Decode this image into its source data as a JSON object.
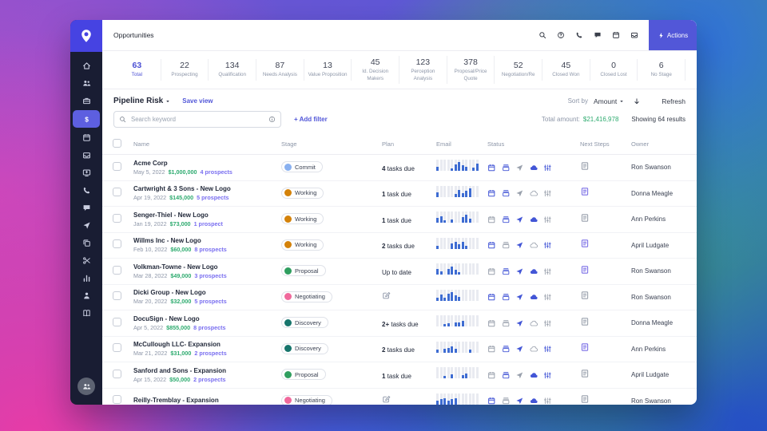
{
  "header": {
    "title": "Opportunities",
    "icons": [
      "search",
      "help",
      "phone",
      "chat",
      "calendar",
      "inbox"
    ],
    "actions_label": "Actions"
  },
  "sidebar": {
    "icons": [
      "home",
      "users",
      "briefcase",
      "dollar",
      "calendar",
      "inbox",
      "screen-plus",
      "phone",
      "chat",
      "send",
      "copy",
      "scissors",
      "chart",
      "user",
      "book"
    ],
    "active_index": 3,
    "footer_icon": "users"
  },
  "stats": [
    {
      "value": "63",
      "label": "Total"
    },
    {
      "value": "22",
      "label": "Prospecting"
    },
    {
      "value": "134",
      "label": "Qualification"
    },
    {
      "value": "87",
      "label": "Needs Analysis"
    },
    {
      "value": "13",
      "label": "Value Proposition"
    },
    {
      "value": "45",
      "label": "Id. Decision Makers"
    },
    {
      "value": "123",
      "label": "Perception Analysis"
    },
    {
      "value": "378",
      "label": "Proposal/Price Quote"
    },
    {
      "value": "52",
      "label": "Negotiation/Re"
    },
    {
      "value": "45",
      "label": "Closed Won"
    },
    {
      "value": "0",
      "label": "Closed Lost"
    },
    {
      "value": "6",
      "label": "No Stage"
    }
  ],
  "toolbar": {
    "view_name": "Pipeline Risk",
    "save_view": "Save view",
    "sort_by": "Sort by",
    "sort_value": "Amount",
    "refresh": "Refresh"
  },
  "filters": {
    "search_placeholder": "Search keyword",
    "add_filter": "+ Add filter",
    "total_amount_label": "Total amount:",
    "total_amount": "$21,416,978",
    "results": "Showing 64 results"
  },
  "table": {
    "headers": [
      "Name",
      "Stage",
      "Plan",
      "Email",
      "Status",
      "Next Steps",
      "Owner"
    ],
    "rows": [
      {
        "name": "Acme Corp",
        "date": "May 5, 2022",
        "amount": "$1,000,000",
        "prospects": "4 prospects",
        "stage": "Commit",
        "plan": {
          "bold": "4",
          "text": " tasks due",
          "icon": false
        },
        "bars": [
          0.35,
          0,
          0,
          0,
          0.2,
          0.6,
          0.8,
          0.55,
          0.35,
          0,
          0.3,
          0.65
        ],
        "status": {
          "calendar": true,
          "tray": true,
          "send": false,
          "cloud": true,
          "pulse": true
        },
        "note": false,
        "owner": "Ron Swanson"
      },
      {
        "name": "Cartwright & 3 Sons - New Logo",
        "date": "Apr 19, 2022",
        "amount": "$145,000",
        "prospects": "5 prospects",
        "stage": "Working",
        "plan": {
          "bold": "1",
          "text": " task due",
          "icon": false
        },
        "bars": [
          0.4,
          0,
          0,
          0,
          0,
          0.3,
          0.6,
          0.35,
          0.55,
          0.75,
          0,
          0
        ],
        "status": {
          "calendar": true,
          "tray": true,
          "send": false,
          "cloud": false,
          "pulse": false
        },
        "note": true,
        "owner": "Donna Meagle"
      },
      {
        "name": "Senger-Thiel - New Logo",
        "date": "Jan 19, 2022",
        "amount": "$73,000",
        "prospects": "1 prospect",
        "stage": "Working",
        "plan": {
          "bold": "1",
          "text": " task due",
          "icon": false
        },
        "bars": [
          0.45,
          0.6,
          0.25,
          0,
          0.3,
          0,
          0,
          0.55,
          0.7,
          0.35,
          0,
          0
        ],
        "status": {
          "calendar": false,
          "tray": true,
          "send": true,
          "cloud": true,
          "pulse": false
        },
        "note": false,
        "owner": "Ann Perkins"
      },
      {
        "name": "Willms Inc - New Logo",
        "date": "Feb 10, 2022",
        "amount": "$60,000",
        "prospects": "8 prospects",
        "stage": "Working",
        "plan": {
          "bold": "2",
          "text": " tasks due",
          "icon": false
        },
        "bars": [
          0.25,
          0,
          0,
          0,
          0.5,
          0.65,
          0.4,
          0.6,
          0.3,
          0,
          0,
          0
        ],
        "status": {
          "calendar": true,
          "tray": false,
          "send": true,
          "cloud": false,
          "pulse": true
        },
        "note": true,
        "owner": "April Ludgate"
      },
      {
        "name": "Volkman-Towne - New Logo",
        "date": "Mar 28, 2022",
        "amount": "$49,000",
        "prospects": "3 prospects",
        "stage": "Proposal",
        "plan": {
          "bold": "",
          "text": "Up to date",
          "icon": false
        },
        "bars": [
          0.55,
          0.3,
          0,
          0.5,
          0.7,
          0.45,
          0.25,
          0,
          0,
          0,
          0,
          0
        ],
        "status": {
          "calendar": false,
          "tray": true,
          "send": true,
          "cloud": true,
          "pulse": false
        },
        "note": true,
        "owner": "Ron Swanson"
      },
      {
        "name": "Dicki Group - New Logo",
        "date": "Mar 20, 2022",
        "amount": "$32,000",
        "prospects": "5 prospects",
        "stage": "Negotiating",
        "plan": {
          "bold": "",
          "text": "",
          "icon": true
        },
        "bars": [
          0.3,
          0.55,
          0.3,
          0.65,
          0.8,
          0.45,
          0.35,
          0,
          0,
          0,
          0,
          0
        ],
        "status": {
          "calendar": true,
          "tray": true,
          "send": true,
          "cloud": true,
          "pulse": false
        },
        "note": false,
        "owner": "Ron Swanson"
      },
      {
        "name": "DocuSign - New Logo",
        "date": "Apr 5, 2022",
        "amount": "$855,000",
        "prospects": "8 prospects",
        "stage": "Discovery",
        "plan": {
          "bold": "2+",
          "text": " tasks due",
          "icon": false
        },
        "bars": [
          0,
          0,
          0.25,
          0.3,
          0,
          0.4,
          0.35,
          0.5,
          0,
          0,
          0,
          0
        ],
        "status": {
          "calendar": false,
          "tray": false,
          "send": true,
          "cloud": false,
          "pulse": false
        },
        "note": false,
        "owner": "Donna Meagle"
      },
      {
        "name": "McCullough LLC- Expansion",
        "date": "Mar 21, 2022",
        "amount": "$31,000",
        "prospects": "2 prospects",
        "stage": "Discovery",
        "plan": {
          "bold": "2",
          "text": " tasks due",
          "icon": false
        },
        "bars": [
          0.3,
          0,
          0.35,
          0.4,
          0.55,
          0.35,
          0,
          0,
          0,
          0.25,
          0,
          0
        ],
        "status": {
          "calendar": false,
          "tray": true,
          "send": true,
          "cloud": false,
          "pulse": true
        },
        "note": true,
        "owner": "Ann Perkins"
      },
      {
        "name": "Sanford and Sons - Expansion",
        "date": "Apr 15, 2022",
        "amount": "$50,000",
        "prospects": "2 prospects",
        "stage": "Proposal",
        "plan": {
          "bold": "1",
          "text": " task due",
          "icon": false
        },
        "bars": [
          0,
          0,
          0.25,
          0,
          0.35,
          0,
          0,
          0.3,
          0.45,
          0,
          0,
          0
        ],
        "status": {
          "calendar": false,
          "tray": true,
          "send": false,
          "cloud": true,
          "pulse": true
        },
        "note": false,
        "owner": "April Ludgate"
      },
      {
        "name": "Reilly-Tremblay - Expansion",
        "date": "",
        "amount": "",
        "prospects": "",
        "stage": "Negotiating",
        "plan": {
          "bold": "",
          "text": "",
          "icon": true
        },
        "bars": [
          0.35,
          0.45,
          0.55,
          0.35,
          0.5,
          0.55,
          0,
          0,
          0,
          0,
          0,
          0
        ],
        "status": {
          "calendar": true,
          "tray": false,
          "send": true,
          "cloud": true,
          "pulse": false
        },
        "note": false,
        "owner": "Ron Swanson"
      }
    ]
  },
  "colors": {
    "accent": "#5257d8",
    "green": "#2eab6f",
    "link_purple": "#7a6ff0",
    "status_active": "#4356d6",
    "status_inactive": "#9aa1ad",
    "stages": {
      "Commit": "#8ab1f0",
      "Working": "#d4820a",
      "Proposal": "#2f9e5f",
      "Negotiating": "#f0699c",
      "Discovery": "#17756c"
    }
  }
}
